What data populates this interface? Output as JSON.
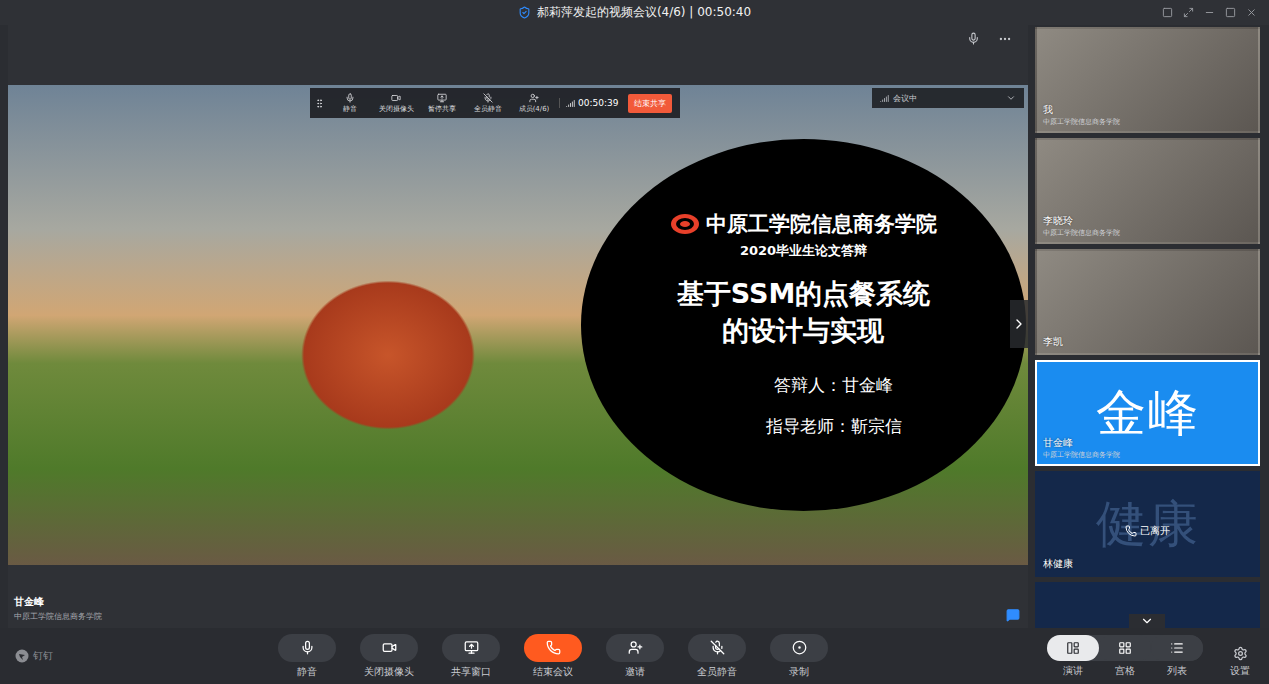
{
  "window": {
    "title": "郝莉萍发起的视频会议(4/6) | 00:50:40"
  },
  "share_bar": {
    "buttons": [
      "静音",
      "关闭摄像头",
      "暂停共享",
      "全员静音",
      "成员(4/6)"
    ],
    "timer": "00:50:39",
    "stop": "结束共享",
    "status": "会议中"
  },
  "slide": {
    "school": "中原工学院信息商务学院",
    "event": "2020毕业生论文答辩",
    "title_lines": [
      "基于SSM的点餐系统",
      "的设计与实现"
    ],
    "presenter": "答辩人：甘金峰",
    "advisor": "指导老师：靳宗信"
  },
  "speaker": {
    "name": "甘金峰",
    "org": "中原工学院信息商务学院"
  },
  "participants": [
    {
      "name": "我",
      "org": "中原工学院信息商务学院",
      "kind": "video",
      "selected": false
    },
    {
      "name": "李晓玲",
      "org": "中原工学院信息商务学院",
      "kind": "video",
      "selected": false
    },
    {
      "name": "李凯",
      "org": "",
      "kind": "video",
      "selected": false
    },
    {
      "name": "甘金峰",
      "org": "中原工学院信息商务学院",
      "kind": "avatar",
      "avatar": "金峰",
      "selected": true
    },
    {
      "name": "林健康",
      "org": "",
      "kind": "avatar",
      "avatar": "健康",
      "status": "已离开",
      "selected": false
    }
  ],
  "toolbar": {
    "brand": "钉钉",
    "buttons": [
      {
        "label": "静音",
        "kind": "normal"
      },
      {
        "label": "关闭摄像头",
        "kind": "normal"
      },
      {
        "label": "共享窗口",
        "kind": "normal"
      },
      {
        "label": "结束会议",
        "kind": "danger"
      },
      {
        "label": "邀请",
        "kind": "normal"
      },
      {
        "label": "全员静音",
        "kind": "normal"
      },
      {
        "label": "录制",
        "kind": "normal"
      }
    ],
    "views": [
      {
        "label": "演讲",
        "selected": true
      },
      {
        "label": "宫格",
        "selected": false
      },
      {
        "label": "列表",
        "selected": false
      }
    ],
    "settings": "设置"
  }
}
